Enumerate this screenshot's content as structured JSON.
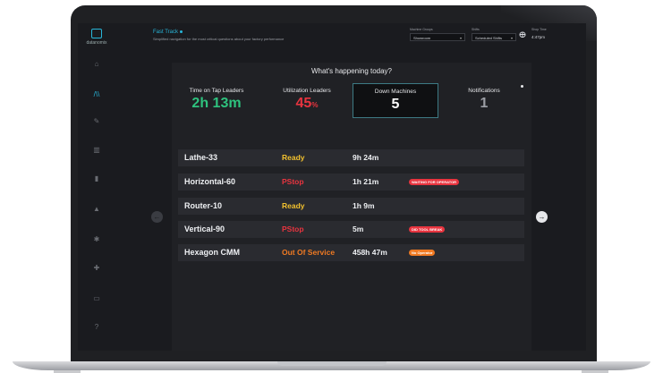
{
  "app": {
    "logo_text": "datanomix",
    "title": "Fast Track",
    "subtitle": "Simplified navigation for the most critical questions about your factory performance"
  },
  "filters": {
    "machine_groups_label": "Machine Groups",
    "machine_groups_value": "Showroom",
    "shifts_label": "Shifts",
    "shifts_value": "Scheduled Shifts",
    "shop_time_label": "Shop Time",
    "shop_time_value": "4:47pm"
  },
  "sidebar": {
    "items": [
      {
        "icon": "home-icon",
        "glyph": "⌂"
      },
      {
        "icon": "fast-track-icon",
        "glyph": "/\\\\",
        "active": true
      },
      {
        "icon": "wrench-icon",
        "glyph": "✎"
      },
      {
        "icon": "chart-icon",
        "glyph": "▥"
      },
      {
        "icon": "document-icon",
        "glyph": "▮"
      },
      {
        "icon": "alert-icon",
        "glyph": "▲"
      },
      {
        "icon": "settings-icon",
        "glyph": "✱"
      },
      {
        "icon": "puzzle-icon",
        "glyph": "✚"
      },
      {
        "icon": "monitor-icon",
        "glyph": "▭"
      },
      {
        "icon": "help-icon",
        "glyph": "?"
      }
    ]
  },
  "panel": {
    "title": "What's happening today?",
    "stats": [
      {
        "label": "Time on Tap Leaders",
        "value": "2h 13m",
        "unit": "",
        "color": "#2ec27e"
      },
      {
        "label": "Utilization Leaders",
        "value": "45",
        "unit": "%",
        "color": "#e8343f"
      },
      {
        "label": "Down Machines",
        "value": "5",
        "unit": "",
        "color": "#ffffff",
        "active": true
      },
      {
        "label": "Notifications",
        "value": "1",
        "unit": "",
        "color": "#9b9ea5"
      }
    ],
    "rows": [
      {
        "name": "Lathe-33",
        "status": "Ready",
        "status_color": "#f2c12e",
        "duration": "9h 24m",
        "badge": "",
        "badge_color": ""
      },
      {
        "name": "Horizontal-60",
        "status": "PStop",
        "status_color": "#e8343f",
        "duration": "1h 21m",
        "badge": "WAITING FOR OPERATOR",
        "badge_color": "#e8343f"
      },
      {
        "name": "Router-10",
        "status": "Ready",
        "status_color": "#f2c12e",
        "duration": "1h 9m",
        "badge": "",
        "badge_color": ""
      },
      {
        "name": "Vertical-90",
        "status": "PStop",
        "status_color": "#e8343f",
        "duration": "5m",
        "badge": "DID TOOL BREAK",
        "badge_color": "#e8343f"
      },
      {
        "name": "Hexagon CMM",
        "status": "Out Of Service",
        "status_color": "#f07a22",
        "duration": "458h 47m",
        "badge": "No Operator",
        "badge_color": "#f07a22"
      }
    ]
  },
  "nav": {
    "prev_glyph": "←",
    "next_glyph": "→"
  }
}
